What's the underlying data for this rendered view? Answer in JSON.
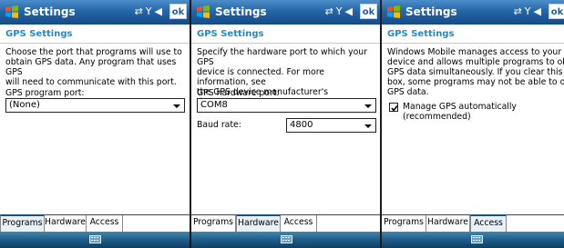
{
  "panels": [
    {
      "titlebar": {
        "title": "Settings",
        "ok_label": "ok"
      },
      "heading": "GPS Settings",
      "description_lines": [
        "Choose the port that programs will use to",
        "obtain GPS data. Any program that uses GPS",
        "will need to communicate with this port."
      ],
      "field_label": "GPS program port:",
      "field_value": "(None)",
      "tabs": [
        "Programs",
        "Hardware",
        "Access"
      ],
      "active_tab": "Programs"
    },
    {
      "titlebar": {
        "title": "Settings",
        "ok_label": "ok"
      },
      "heading": "GPS Settings",
      "description_lines": [
        "Specify the hardware port to which your GPS",
        "device is connected. For more information, see",
        "the GPS device manufacturer's documentation."
      ],
      "field_label": "GPS hardware port:",
      "field_value": "COM8",
      "baud_label": "Baud rate:",
      "baud_value": "4800",
      "tabs": [
        "Programs",
        "Hardware",
        "Access"
      ],
      "active_tab": "Hardware"
    },
    {
      "titlebar": {
        "title": "Settings",
        "ok_label": "ok"
      },
      "heading": "GPS Settings",
      "description_lines": [
        "Windows Mobile manages access to your GPS",
        "device and allows multiple programs to obtain",
        "GPS data simultaneously. If you clear this check",
        "box, some programs may not be able to obtain",
        "GPS data."
      ],
      "checkbox_label": "Manage GPS automatically (recommended)",
      "checkbox_checked": true,
      "tabs": [
        "Programs",
        "Hardware",
        "Access"
      ],
      "active_tab": "Access"
    }
  ],
  "icons": {
    "start": "windows-logo-icon",
    "status": [
      "connectivity-icon",
      "signal-icon",
      "volume-icon"
    ],
    "menu": "keyboard-icon"
  }
}
